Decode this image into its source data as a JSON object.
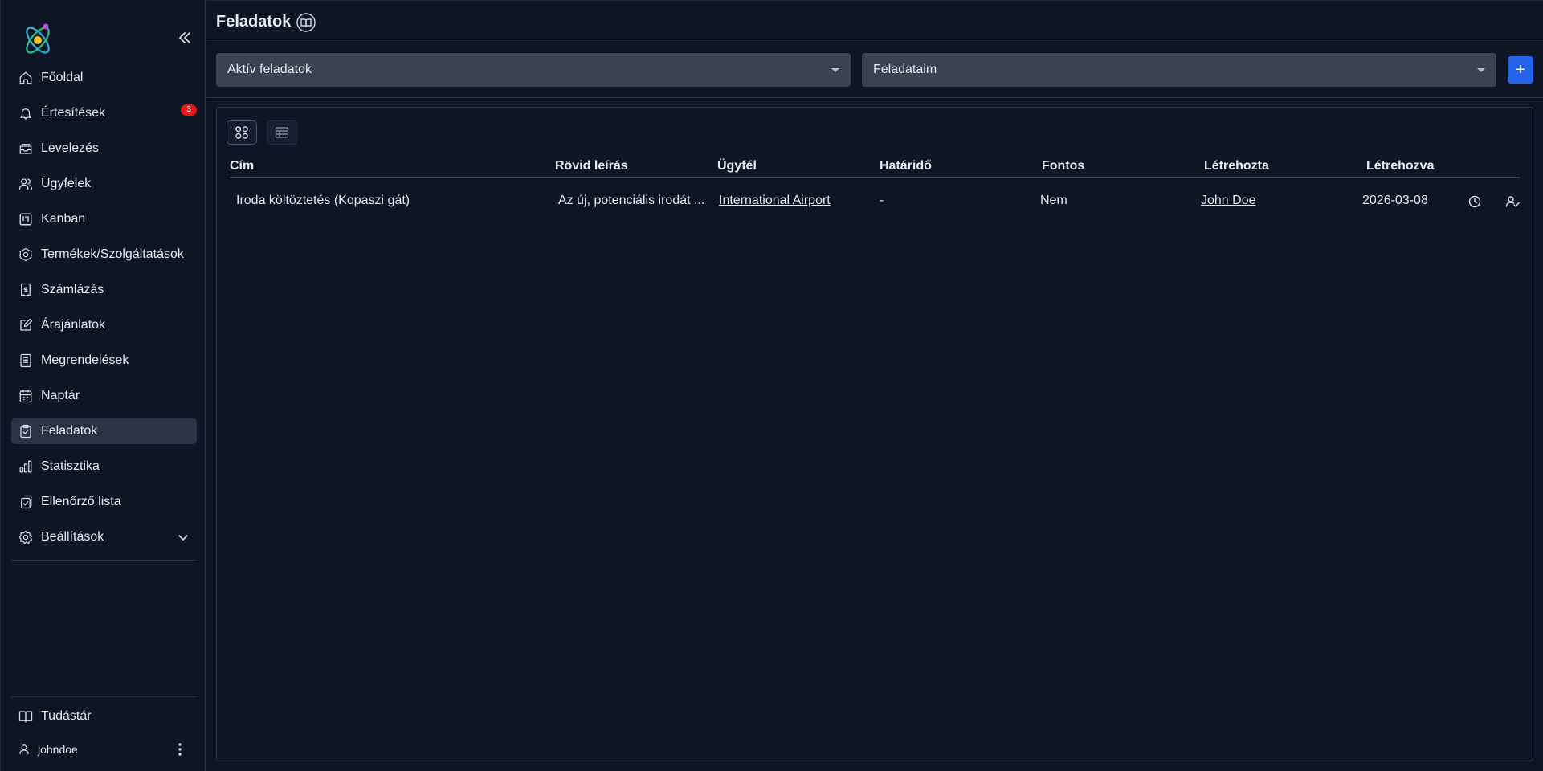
{
  "sidebar": {
    "items": [
      {
        "label": "Főoldal",
        "icon": "home-icon"
      },
      {
        "label": "Értesítések",
        "icon": "bell-icon",
        "badge": "3"
      },
      {
        "label": "Levelezés",
        "icon": "inbox-icon"
      },
      {
        "label": "Ügyfelek",
        "icon": "users-icon"
      },
      {
        "label": "Kanban",
        "icon": "kanban-icon"
      },
      {
        "label": "Termékek/Szolgáltatások",
        "icon": "hexagon-gear-icon"
      },
      {
        "label": "Számlázás",
        "icon": "invoice-icon"
      },
      {
        "label": "Árajánlatok",
        "icon": "quote-edit-icon"
      },
      {
        "label": "Megrendelések",
        "icon": "document-icon"
      },
      {
        "label": "Naptár",
        "icon": "calendar-icon"
      },
      {
        "label": "Feladatok",
        "icon": "clipboard-check-icon",
        "active": true
      },
      {
        "label": "Statisztika",
        "icon": "bar-chart-icon"
      },
      {
        "label": "Ellenőrző lista",
        "icon": "checklist-icon"
      },
      {
        "label": "Beállítások",
        "icon": "gear-icon",
        "expandable": true
      }
    ],
    "knowledge_base": "Tudástár",
    "username": "johndoe"
  },
  "header": {
    "title": "Feladatok"
  },
  "filters": {
    "status_value": "Aktív feladatok",
    "scope_value": "Feladataim",
    "add_label": "+"
  },
  "table": {
    "columns": [
      "Cím",
      "Rövid leírás",
      "Ügyfél",
      "Határidő",
      "Fontos",
      "Létrehozta",
      "Létrehozva"
    ],
    "rows": [
      {
        "title": "Iroda költöztetés (Kopaszi gát)",
        "description": "Az új, potenciális irodát ...",
        "client": "International Airport",
        "deadline": "-",
        "important": "Nem",
        "created_by": "John Doe",
        "created_at": "2026-03-08"
      }
    ]
  },
  "colors": {
    "background": "#0e1626",
    "accent": "#2563eb",
    "badge": "#e01818",
    "active_item": "#2a3445"
  }
}
